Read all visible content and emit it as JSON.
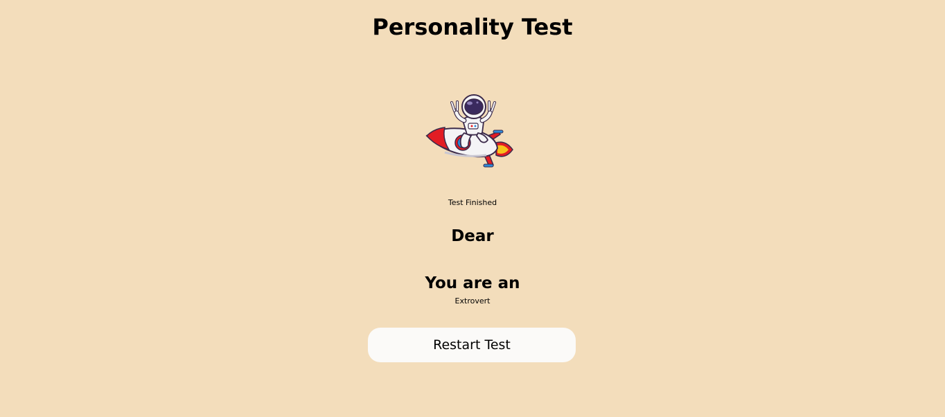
{
  "header": {
    "title": "Personality Test"
  },
  "illustration": {
    "icon": "astronaut-riding-rocket-icon",
    "colors": {
      "helmet_visor": "#3a2a5e",
      "rocket_body": "#f4f4f6",
      "rocket_accent": "#e21c24",
      "window": "#2d8ad8",
      "flame": "#f7c21a"
    }
  },
  "result": {
    "status": "Test Finished",
    "greeting": "Dear",
    "heading": "You are an",
    "personality": "Extrovert"
  },
  "actions": {
    "restart_label": "Restart Test"
  },
  "theme": {
    "background": "#f3ddbb",
    "button_background": "#fbfaf8"
  }
}
